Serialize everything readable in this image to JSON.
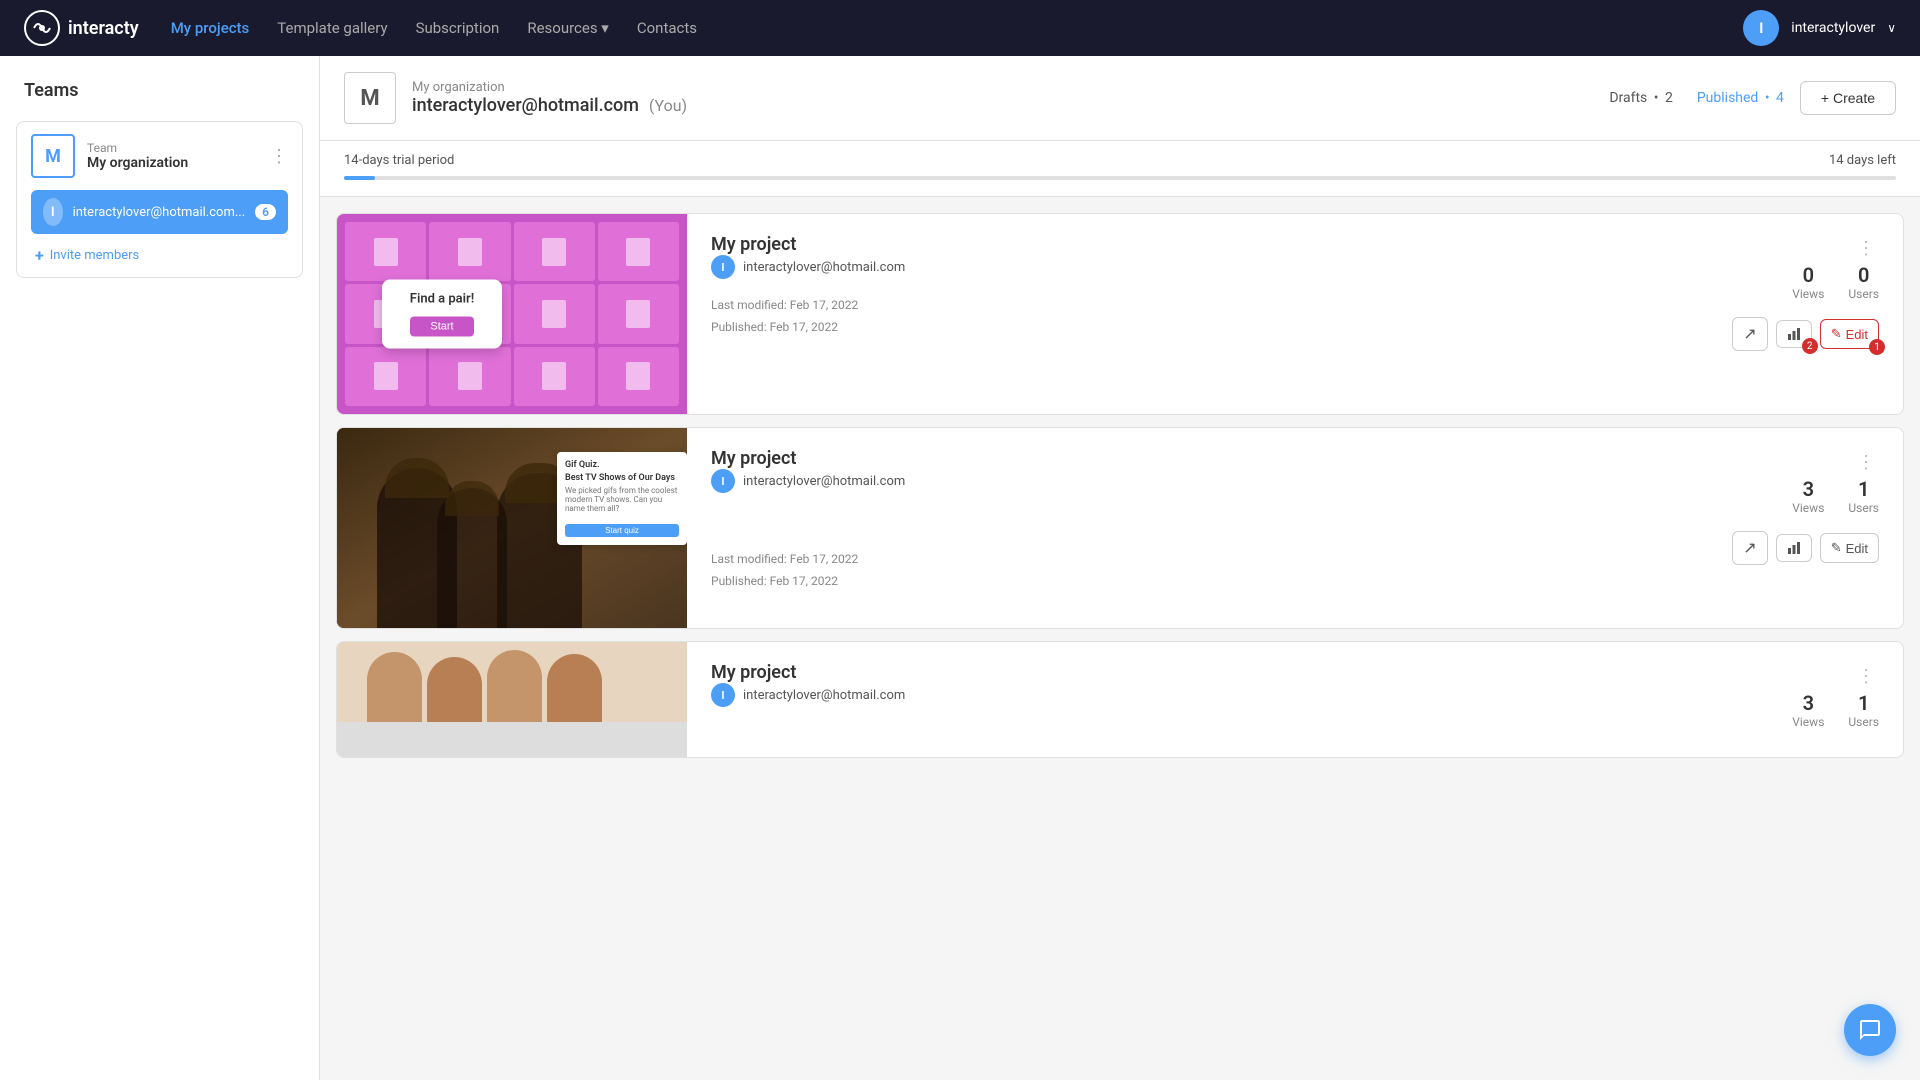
{
  "app": {
    "logo_text": "interacty",
    "logo_icon": "⚙"
  },
  "topnav": {
    "links": [
      {
        "id": "my-projects",
        "label": "My projects",
        "active": true
      },
      {
        "id": "template-gallery",
        "label": "Template gallery",
        "active": false
      },
      {
        "id": "subscription",
        "label": "Subscription",
        "active": false
      },
      {
        "id": "resources",
        "label": "Resources ▾",
        "active": false
      },
      {
        "id": "contacts",
        "label": "Contacts",
        "active": false
      }
    ],
    "user": {
      "avatar_letter": "I",
      "name": "interactylover",
      "chevron": "∨"
    }
  },
  "sidebar": {
    "title": "Teams",
    "team": {
      "avatar": "M",
      "label": "Team",
      "name": "My organization",
      "dots": "⋮"
    },
    "member": {
      "avatar": "I",
      "email": "interactylover@hotmail.com...",
      "count": "6"
    },
    "invite": {
      "icon": "+",
      "label": "Invite members"
    }
  },
  "org_header": {
    "avatar": "M",
    "org_name": "My organization",
    "email": "interactylover@hotmail.com",
    "you_label": "(You)",
    "drafts_label": "Drafts",
    "drafts_count": "2",
    "separator": "•",
    "published_label": "Published",
    "published_count": "4",
    "create_btn": "+ Create"
  },
  "trial": {
    "label": "14-days trial period",
    "days_left": "14 days left",
    "progress_pct": 2
  },
  "projects": [
    {
      "id": "project-1",
      "title": "My project",
      "owner_avatar": "I",
      "owner_email": "interactylover@hotmail.com",
      "views": "0",
      "views_label": "Views",
      "users": "0",
      "users_label": "Users",
      "last_modified": "Last modified: Feb 17, 2022",
      "published": "Published: Feb 17, 2022",
      "thumbnail_type": "match-game",
      "thumbnail_title": "Find a pair!",
      "thumbnail_btn": "Start",
      "badge_analytics": "2",
      "badge_edit": "1"
    },
    {
      "id": "project-2",
      "title": "My project",
      "owner_avatar": "I",
      "owner_email": "interactylover@hotmail.com",
      "views": "3",
      "views_label": "Views",
      "users": "1",
      "users_label": "Users",
      "last_modified": "Last modified: Feb 17, 2022",
      "published": "Published: Feb 17, 2022",
      "thumbnail_type": "gif-quiz",
      "thumbnail_title": "Gif Quiz.",
      "thumbnail_subtitle": "Best TV Shows of Our Days",
      "thumbnail_desc": "We picked gifs from the coolest modern TV shows. Can you name them all?",
      "thumbnail_btn": "Start quiz"
    },
    {
      "id": "project-3",
      "title": "My project",
      "owner_avatar": "I",
      "owner_email": "interactylover@hotmail.com",
      "views": "3",
      "views_label": "Views",
      "users": "1",
      "users_label": "Users",
      "thumbnail_type": "people",
      "last_modified": "",
      "published": ""
    }
  ],
  "action_buttons": {
    "external_icon": "↗",
    "analytics_icon": "▐",
    "edit_icon": "✎",
    "edit_label": "Edit",
    "dots": "⋮"
  }
}
